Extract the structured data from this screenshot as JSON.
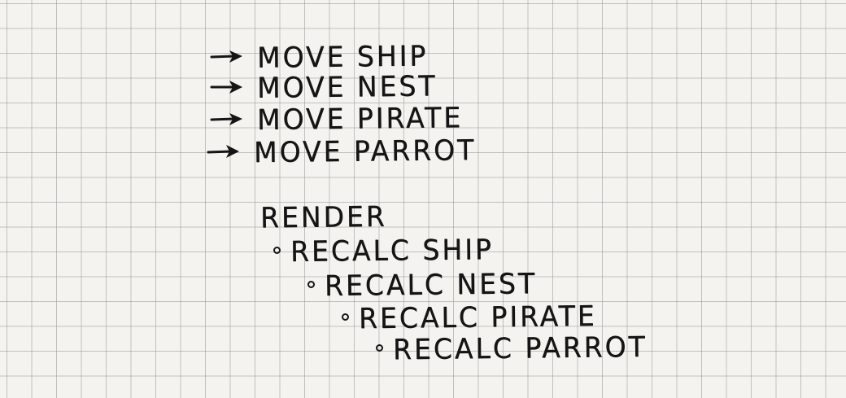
{
  "moves": [
    "MOVE SHIP",
    "MOVE NEST",
    "MOVE PIRATE",
    "MOVE PARROT"
  ],
  "render": {
    "heading": "RENDER",
    "steps": [
      "RECALC SHIP",
      "RECALC NEST",
      "RECALC PIRATE",
      "RECALC PARROT"
    ]
  },
  "icons": {
    "move_marker": "arrow-icon",
    "step_marker": "bullet-icon"
  },
  "colors": {
    "paper": "#f4f3ef",
    "grid": "#969696",
    "ink": "#151515"
  }
}
